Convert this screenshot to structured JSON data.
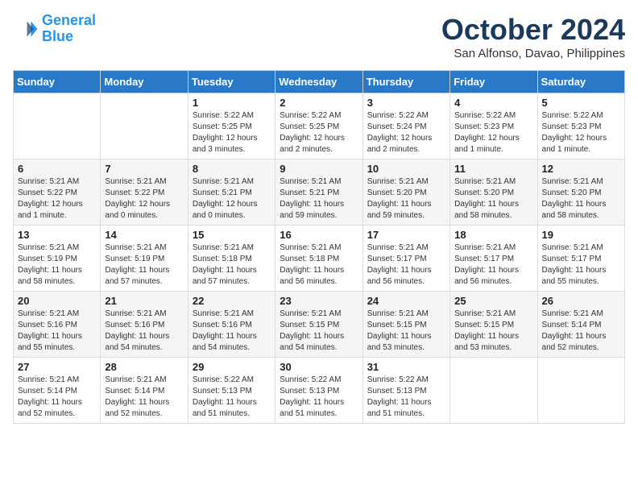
{
  "header": {
    "logo_line1": "General",
    "logo_line2": "Blue",
    "month_title": "October 2024",
    "subtitle": "San Alfonso, Davao, Philippines"
  },
  "days_of_week": [
    "Sunday",
    "Monday",
    "Tuesday",
    "Wednesday",
    "Thursday",
    "Friday",
    "Saturday"
  ],
  "weeks": [
    [
      {
        "day": "",
        "info": ""
      },
      {
        "day": "",
        "info": ""
      },
      {
        "day": "1",
        "info": "Sunrise: 5:22 AM\nSunset: 5:25 PM\nDaylight: 12 hours and 3 minutes."
      },
      {
        "day": "2",
        "info": "Sunrise: 5:22 AM\nSunset: 5:25 PM\nDaylight: 12 hours and 2 minutes."
      },
      {
        "day": "3",
        "info": "Sunrise: 5:22 AM\nSunset: 5:24 PM\nDaylight: 12 hours and 2 minutes."
      },
      {
        "day": "4",
        "info": "Sunrise: 5:22 AM\nSunset: 5:23 PM\nDaylight: 12 hours and 1 minute."
      },
      {
        "day": "5",
        "info": "Sunrise: 5:22 AM\nSunset: 5:23 PM\nDaylight: 12 hours and 1 minute."
      }
    ],
    [
      {
        "day": "6",
        "info": "Sunrise: 5:21 AM\nSunset: 5:22 PM\nDaylight: 12 hours and 1 minute."
      },
      {
        "day": "7",
        "info": "Sunrise: 5:21 AM\nSunset: 5:22 PM\nDaylight: 12 hours and 0 minutes."
      },
      {
        "day": "8",
        "info": "Sunrise: 5:21 AM\nSunset: 5:21 PM\nDaylight: 12 hours and 0 minutes."
      },
      {
        "day": "9",
        "info": "Sunrise: 5:21 AM\nSunset: 5:21 PM\nDaylight: 11 hours and 59 minutes."
      },
      {
        "day": "10",
        "info": "Sunrise: 5:21 AM\nSunset: 5:20 PM\nDaylight: 11 hours and 59 minutes."
      },
      {
        "day": "11",
        "info": "Sunrise: 5:21 AM\nSunset: 5:20 PM\nDaylight: 11 hours and 58 minutes."
      },
      {
        "day": "12",
        "info": "Sunrise: 5:21 AM\nSunset: 5:20 PM\nDaylight: 11 hours and 58 minutes."
      }
    ],
    [
      {
        "day": "13",
        "info": "Sunrise: 5:21 AM\nSunset: 5:19 PM\nDaylight: 11 hours and 58 minutes."
      },
      {
        "day": "14",
        "info": "Sunrise: 5:21 AM\nSunset: 5:19 PM\nDaylight: 11 hours and 57 minutes."
      },
      {
        "day": "15",
        "info": "Sunrise: 5:21 AM\nSunset: 5:18 PM\nDaylight: 11 hours and 57 minutes."
      },
      {
        "day": "16",
        "info": "Sunrise: 5:21 AM\nSunset: 5:18 PM\nDaylight: 11 hours and 56 minutes."
      },
      {
        "day": "17",
        "info": "Sunrise: 5:21 AM\nSunset: 5:17 PM\nDaylight: 11 hours and 56 minutes."
      },
      {
        "day": "18",
        "info": "Sunrise: 5:21 AM\nSunset: 5:17 PM\nDaylight: 11 hours and 56 minutes."
      },
      {
        "day": "19",
        "info": "Sunrise: 5:21 AM\nSunset: 5:17 PM\nDaylight: 11 hours and 55 minutes."
      }
    ],
    [
      {
        "day": "20",
        "info": "Sunrise: 5:21 AM\nSunset: 5:16 PM\nDaylight: 11 hours and 55 minutes."
      },
      {
        "day": "21",
        "info": "Sunrise: 5:21 AM\nSunset: 5:16 PM\nDaylight: 11 hours and 54 minutes."
      },
      {
        "day": "22",
        "info": "Sunrise: 5:21 AM\nSunset: 5:16 PM\nDaylight: 11 hours and 54 minutes."
      },
      {
        "day": "23",
        "info": "Sunrise: 5:21 AM\nSunset: 5:15 PM\nDaylight: 11 hours and 54 minutes."
      },
      {
        "day": "24",
        "info": "Sunrise: 5:21 AM\nSunset: 5:15 PM\nDaylight: 11 hours and 53 minutes."
      },
      {
        "day": "25",
        "info": "Sunrise: 5:21 AM\nSunset: 5:15 PM\nDaylight: 11 hours and 53 minutes."
      },
      {
        "day": "26",
        "info": "Sunrise: 5:21 AM\nSunset: 5:14 PM\nDaylight: 11 hours and 52 minutes."
      }
    ],
    [
      {
        "day": "27",
        "info": "Sunrise: 5:21 AM\nSunset: 5:14 PM\nDaylight: 11 hours and 52 minutes."
      },
      {
        "day": "28",
        "info": "Sunrise: 5:21 AM\nSunset: 5:14 PM\nDaylight: 11 hours and 52 minutes."
      },
      {
        "day": "29",
        "info": "Sunrise: 5:22 AM\nSunset: 5:13 PM\nDaylight: 11 hours and 51 minutes."
      },
      {
        "day": "30",
        "info": "Sunrise: 5:22 AM\nSunset: 5:13 PM\nDaylight: 11 hours and 51 minutes."
      },
      {
        "day": "31",
        "info": "Sunrise: 5:22 AM\nSunset: 5:13 PM\nDaylight: 11 hours and 51 minutes."
      },
      {
        "day": "",
        "info": ""
      },
      {
        "day": "",
        "info": ""
      }
    ]
  ]
}
